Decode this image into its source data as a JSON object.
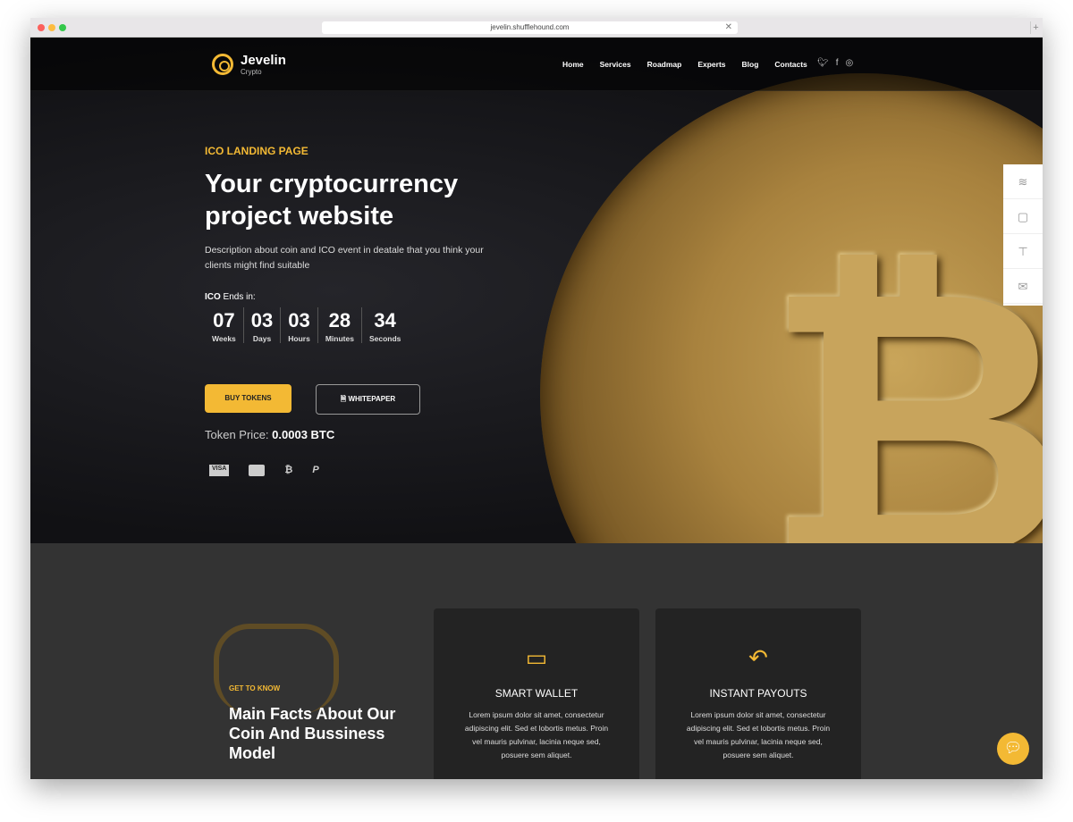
{
  "browser": {
    "url": "jevelin.shufflehound.com"
  },
  "brand": {
    "name": "Jevelin",
    "tagline": "Crypto"
  },
  "nav": [
    "Home",
    "Services",
    "Roadmap",
    "Experts",
    "Blog",
    "Contacts"
  ],
  "hero": {
    "pretitle": "ICO LANDING PAGE",
    "title": "Your cryptocurrency project website",
    "description": "Description about coin and ICO event in deatale that you think your clients might find suitable",
    "ends_bold": "ICO",
    "ends_rest": " Ends in:",
    "countdown": [
      {
        "n": "07",
        "l": "Weeks"
      },
      {
        "n": "03",
        "l": "Days"
      },
      {
        "n": "03",
        "l": "Hours"
      },
      {
        "n": "28",
        "l": "Minutes"
      },
      {
        "n": "34",
        "l": "Seconds"
      }
    ],
    "buy": "BUY TOKENS",
    "whitepaper": "WHITEPAPER",
    "price_label": "Token Price: ",
    "price_value": "0.0003 BTC",
    "payments": [
      "VISA",
      "MC",
      "₿",
      "P"
    ]
  },
  "facts": {
    "pretitle": "GET TO KNOW",
    "title": "Main Facts About Our Coin And Bussiness Model"
  },
  "cards": [
    {
      "title": "SMART WALLET",
      "text": "Lorem ipsum dolor sit amet, consectetur adipiscing elit. Sed et lobortis metus. Proin vel mauris pulvinar, lacinia neque sed, posuere sem aliquet."
    },
    {
      "title": "INSTANT PAYOUTS",
      "text": "Lorem ipsum dolor sit amet, consectetur adipiscing elit. Sed et lobortis metus. Proin vel mauris pulvinar, lacinia neque sed, posuere sem aliquet."
    }
  ]
}
